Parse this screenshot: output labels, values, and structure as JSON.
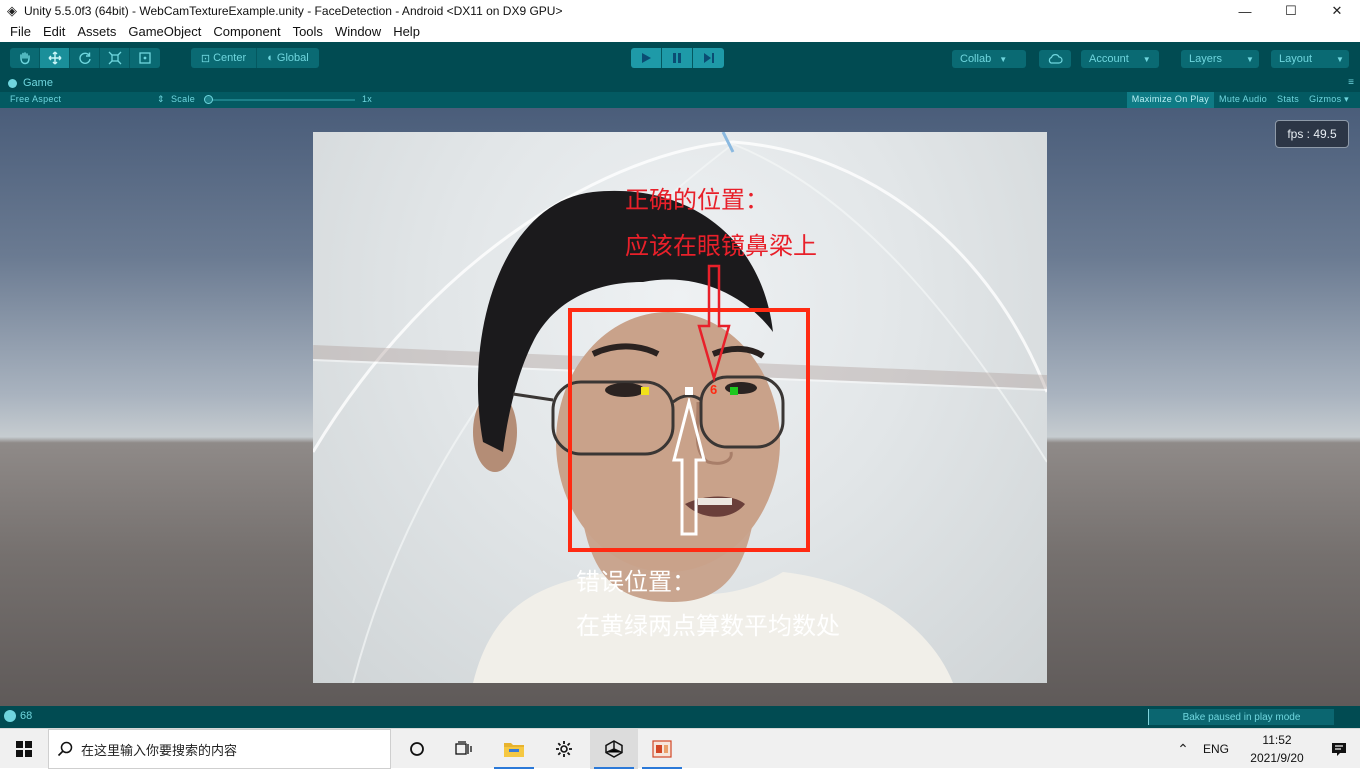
{
  "window": {
    "title": "Unity 5.5.0f3 (64bit) - WebCamTextureExample.unity - FaceDetection - Android <DX11 on DX9 GPU>",
    "minimize_glyph": "—",
    "maximize_glyph": "☐",
    "close_glyph": "✕"
  },
  "menu": [
    "File",
    "Edit",
    "Assets",
    "GameObject",
    "Component",
    "Tools",
    "Window",
    "Help"
  ],
  "toolbar": {
    "pivot_label": "Center",
    "space_label": "Global",
    "collab_label": "Collab",
    "account_label": "Account",
    "layers_label": "Layers",
    "layout_label": "Layout"
  },
  "game_view": {
    "tab_label": "Game",
    "aspect_label": "Free Aspect",
    "scale_label": "Scale",
    "scale_value": "1x",
    "maximize_on_play": "Maximize On Play",
    "mute_audio": "Mute Audio",
    "stats": "Stats",
    "gizmos": "Gizmos",
    "fps_text": "fps : 49.5"
  },
  "annotations": {
    "correct_title": "正确的位置：",
    "correct_desc": "应该在眼镜鼻梁上",
    "wrong_title": "错误位置：",
    "wrong_desc": "在黄绿两点算数平均数处",
    "red_marker_value": "6",
    "colors": {
      "box": "#ff2a12",
      "correct_text": "#e8202a",
      "wrong_text": "#ffffff",
      "yellow_point": "#f2e21a",
      "green_point": "#1ec81e",
      "white_point": "#ffffff"
    }
  },
  "status": {
    "message_count": "68",
    "bake_status": "Bake paused in play mode"
  },
  "taskbar": {
    "search_placeholder": "在这里输入你要搜索的内容",
    "lang": "ENG",
    "time": "11:52",
    "date": "2021/9/20"
  }
}
